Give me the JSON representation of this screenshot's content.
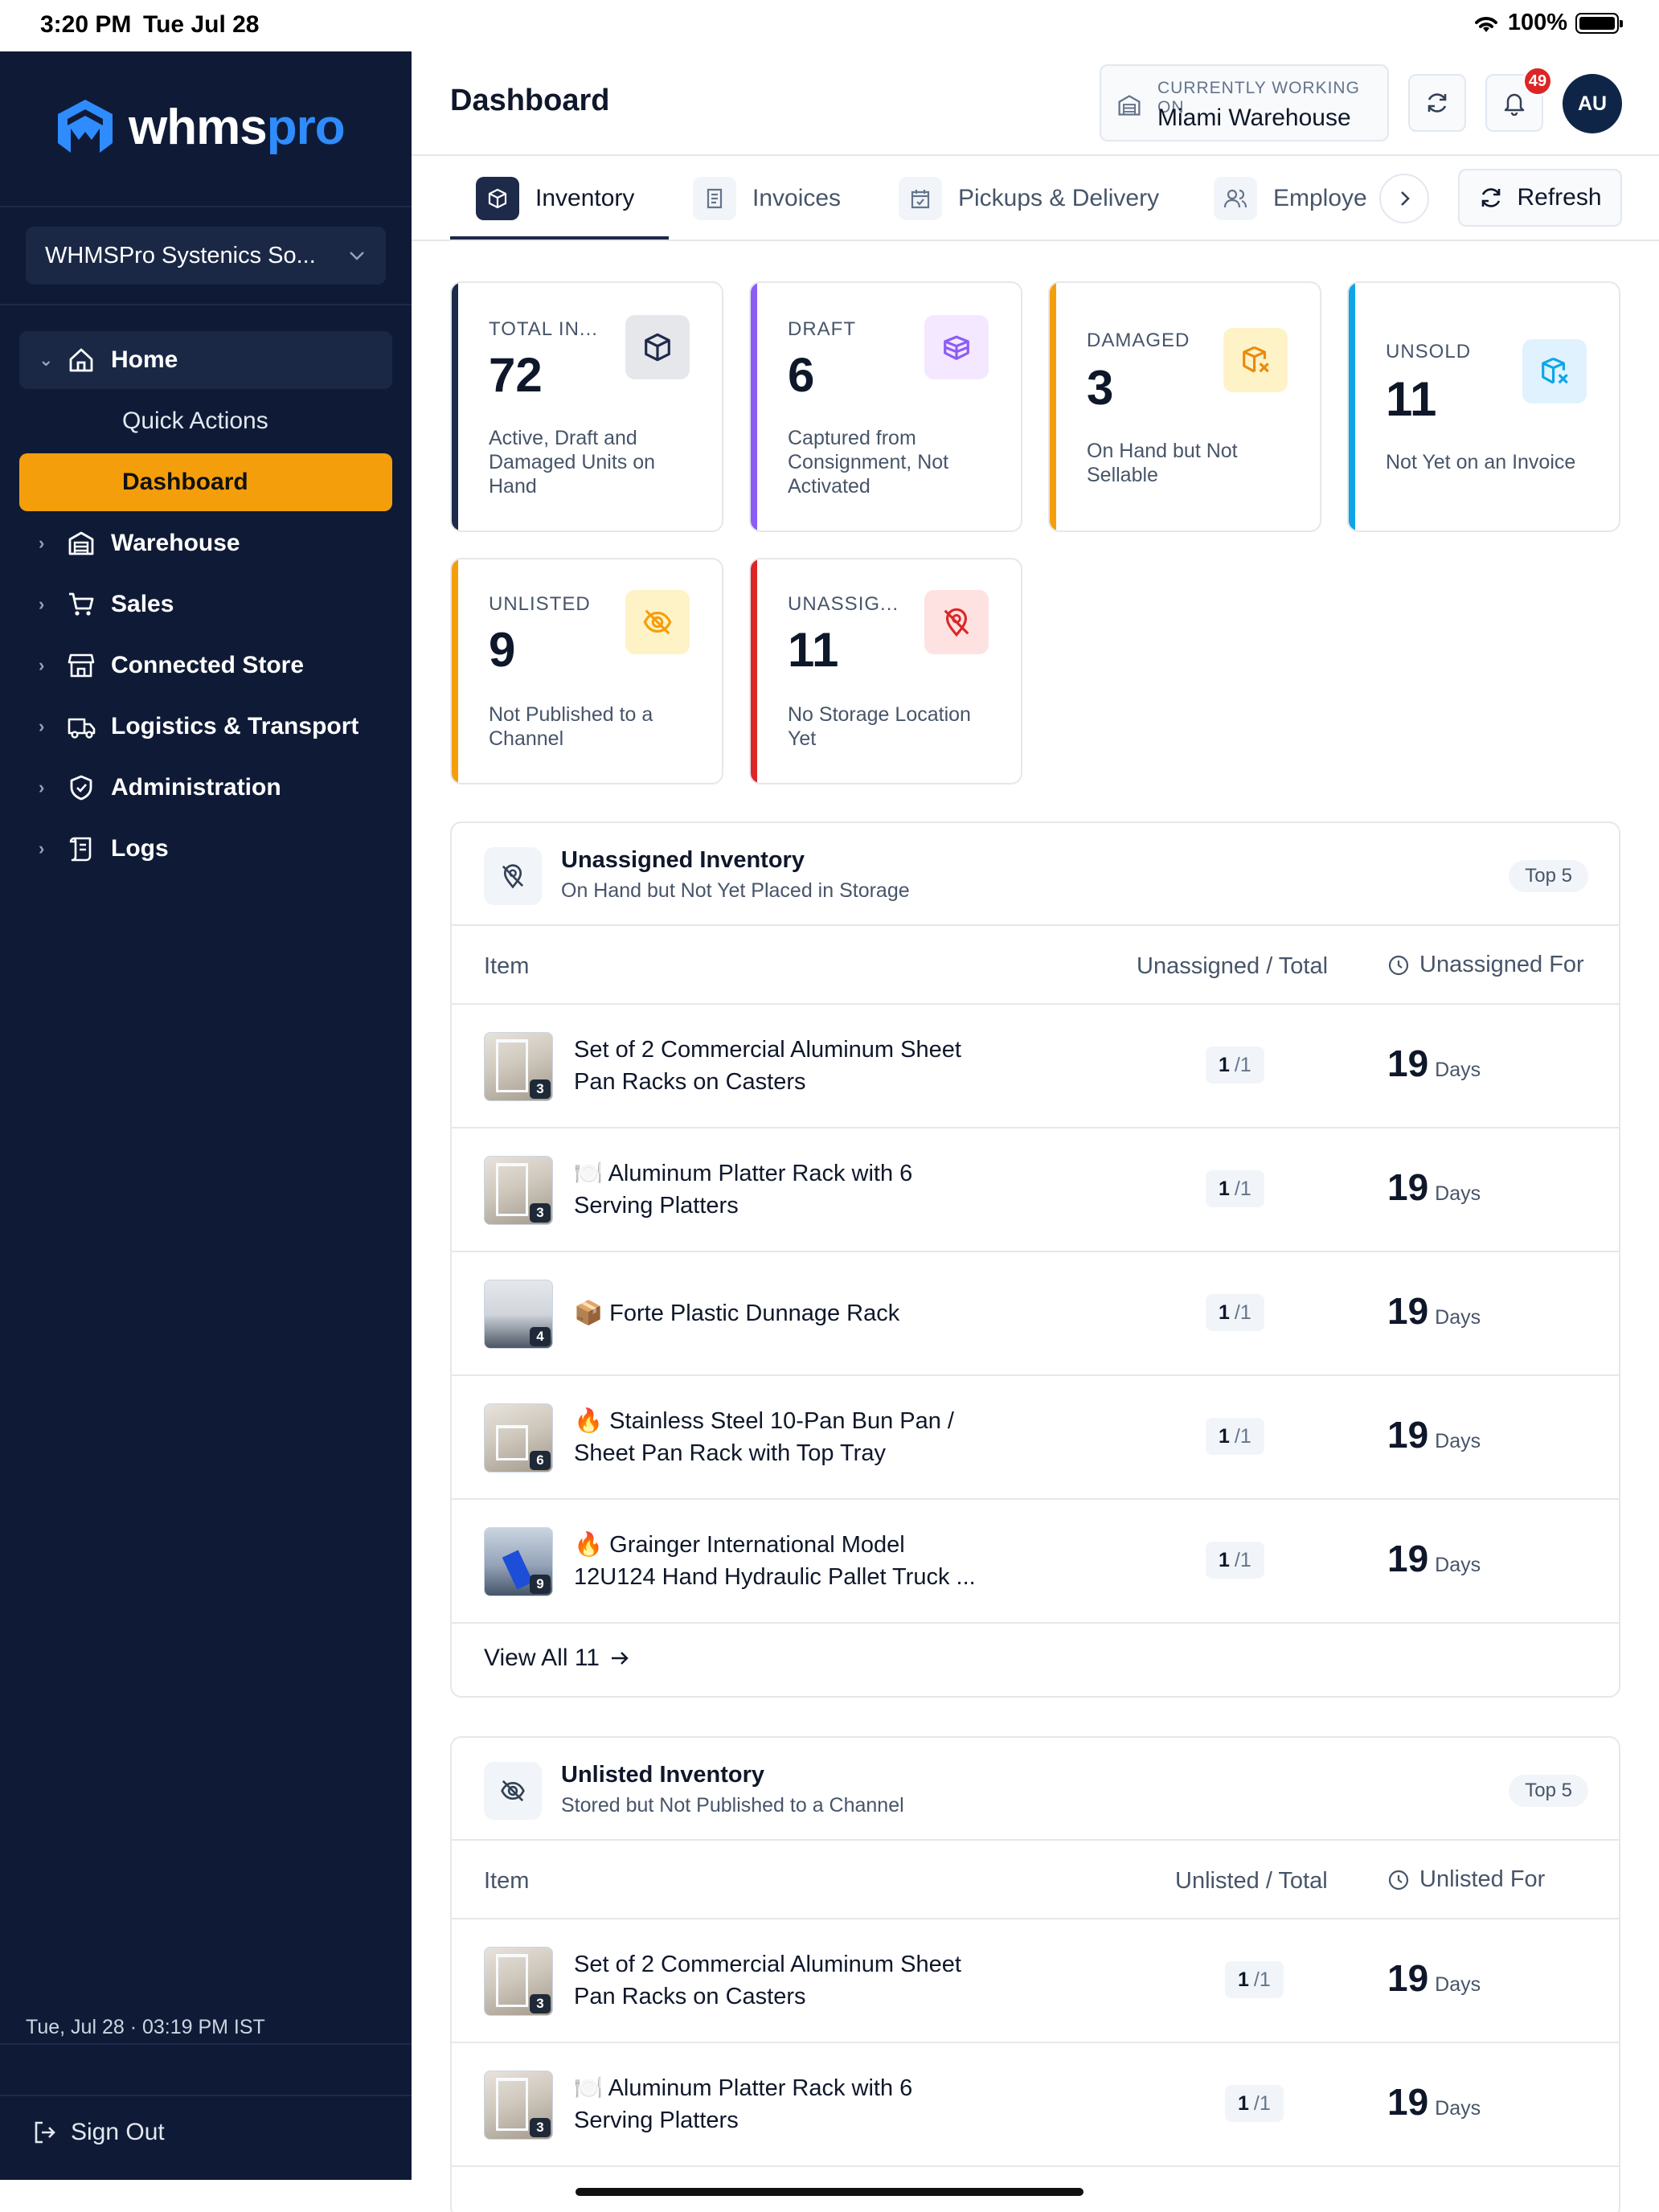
{
  "status_bar": {
    "time": "3:20 PM",
    "date": "Tue Jul 28",
    "battery": "100%"
  },
  "sidebar": {
    "logo_main": "whms",
    "logo_accent": "pro",
    "org": "WHMSPro Systenics So...",
    "nav": {
      "home": "Home",
      "quick_actions": "Quick Actions",
      "dashboard": "Dashboard",
      "warehouse": "Warehouse",
      "sales": "Sales",
      "connected_store": "Connected Store",
      "logistics": "Logistics & Transport",
      "administration": "Administration",
      "logs": "Logs"
    },
    "datetime": "Tue, Jul 28 · 03:19 PM IST",
    "sign_out": "Sign Out"
  },
  "header": {
    "title": "Dashboard",
    "working_label": "CURRENTLY WORKING ON",
    "working_value": "Miami Warehouse",
    "notifications": "49",
    "avatar": "AU"
  },
  "tabs": {
    "inventory": "Inventory",
    "invoices": "Invoices",
    "pickups": "Pickups & Delivery",
    "employees": "Employe",
    "refresh": "Refresh"
  },
  "cards": [
    {
      "label": "TOTAL IN...",
      "value": "72",
      "desc": "Active, Draft and Damaged Units on Hand",
      "accent": "#1e2a4a"
    },
    {
      "label": "DRAFT",
      "value": "6",
      "desc": "Captured from Consignment, Not Activated",
      "accent": "#8b5cf6"
    },
    {
      "label": "DAMAGED",
      "value": "3",
      "desc": "On Hand but Not Sellable",
      "accent": "#f59e0b"
    },
    {
      "label": "UNSOLD",
      "value": "11",
      "desc": "Not Yet on an Invoice",
      "accent": "#0ea5e9"
    },
    {
      "label": "UNLISTED",
      "value": "9",
      "desc": "Not Published to a Channel",
      "accent": "#f59e0b"
    },
    {
      "label": "UNASSIG...",
      "value": "11",
      "desc": "No Storage Location Yet",
      "accent": "#dc2626"
    }
  ],
  "unassigned": {
    "title": "Unassigned Inventory",
    "subtitle": "On Hand but Not Yet Placed in Storage",
    "badge": "Top 5",
    "col_item": "Item",
    "col_ratio": "Unassigned / Total",
    "col_for": "Unassigned For",
    "rows": [
      {
        "name": "Set of 2 Commercial Aluminum Sheet Pan Racks on Casters",
        "count": "3",
        "num": "1",
        "den": "/1",
        "days": "19",
        "unit": "Days"
      },
      {
        "name": "🍽️ Aluminum Platter Rack with 6 Serving Platters",
        "count": "3",
        "num": "1",
        "den": "/1",
        "days": "19",
        "unit": "Days"
      },
      {
        "name": "📦 Forte Plastic Dunnage Rack",
        "count": "4",
        "num": "1",
        "den": "/1",
        "days": "19",
        "unit": "Days"
      },
      {
        "name": "🔥 Stainless Steel 10-Pan Bun Pan / Sheet Pan Rack with Top Tray",
        "count": "6",
        "num": "1",
        "den": "/1",
        "days": "19",
        "unit": "Days"
      },
      {
        "name": "🔥 Grainger International Model 12U124 Hand Hydraulic Pallet Truck ...",
        "count": "9",
        "num": "1",
        "den": "/1",
        "days": "19",
        "unit": "Days"
      }
    ],
    "view_all": "View All 11"
  },
  "unlisted": {
    "title": "Unlisted Inventory",
    "subtitle": "Stored but Not Published to a Channel",
    "badge": "Top 5",
    "col_item": "Item",
    "col_ratio": "Unlisted / Total",
    "col_for": "Unlisted For",
    "rows": [
      {
        "name": "Set of 2 Commercial Aluminum Sheet Pan Racks on Casters",
        "count": "3",
        "num": "1",
        "den": "/1",
        "days": "19",
        "unit": "Days"
      },
      {
        "name": "🍽️ Aluminum Platter Rack with 6 Serving Platters",
        "count": "3",
        "num": "1",
        "den": "/1",
        "days": "19",
        "unit": "Days"
      }
    ]
  }
}
